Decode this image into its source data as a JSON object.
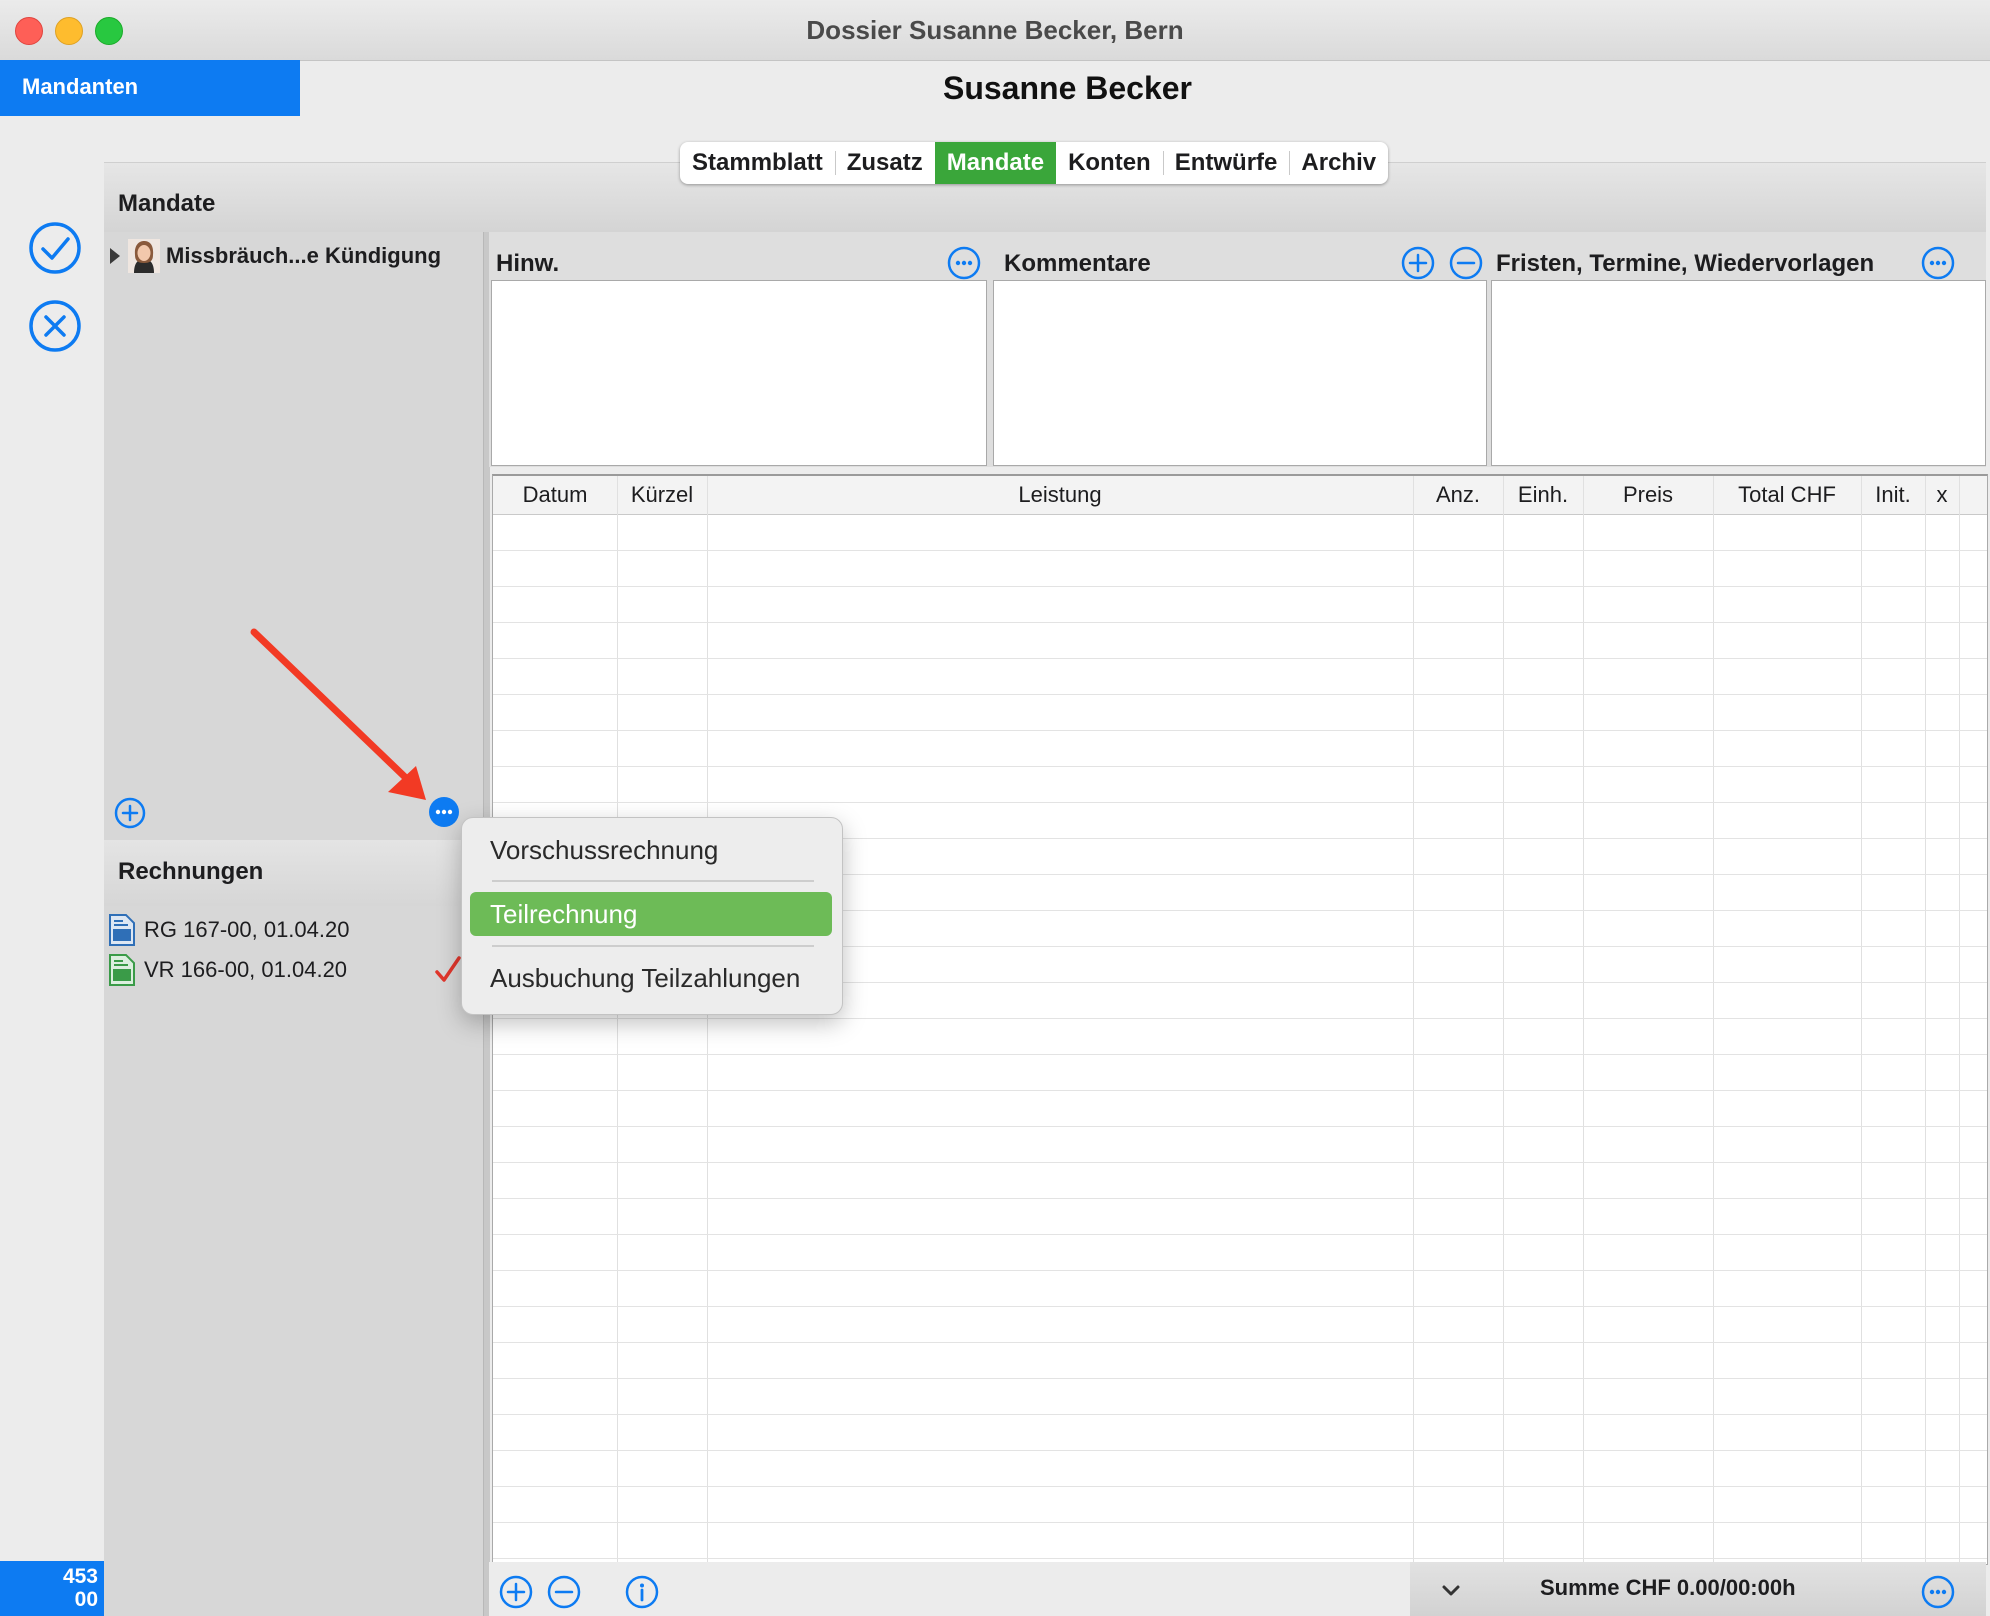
{
  "window": {
    "title": "Dossier Susanne Becker, Bern"
  },
  "nav": {
    "mandanten_label": "Mandanten"
  },
  "header": {
    "client_name": "Susanne Becker"
  },
  "tabs": [
    {
      "label": "Stammblatt",
      "active": false
    },
    {
      "label": "Zusatz",
      "active": false
    },
    {
      "label": "Mandate",
      "active": true
    },
    {
      "label": "Konten",
      "active": false
    },
    {
      "label": "Entwürfe",
      "active": false
    },
    {
      "label": "Archiv",
      "active": false
    }
  ],
  "sidebar": {
    "counter_top": "453",
    "counter_bottom": "00"
  },
  "mandate": {
    "section_title": "Mandate",
    "items": [
      {
        "label": "Missbräuch...e Kündigung"
      }
    ]
  },
  "invoices": {
    "section_title": "Rechnungen",
    "items": [
      {
        "label": "RG 167-00, 01.04.20",
        "icon": "invoice-doc-icon",
        "color": "#2f6fb7"
      },
      {
        "label": "VR 166-00, 01.04.20",
        "icon": "advance-invoice-doc-icon",
        "color": "#3a9b48"
      }
    ]
  },
  "panels": {
    "hinweise": "Hinw.",
    "kommentare": "Kommentare",
    "fristen": "Fristen, Termine, Wiedervorlagen"
  },
  "table": {
    "columns": [
      "Datum",
      "Kürzel",
      "Leistung",
      "Anz.",
      "Einh.",
      "Preis",
      "Total CHF",
      "Init.",
      "x"
    ],
    "rows": []
  },
  "footer": {
    "sum_label": "Summe CHF 0.00/00:00h"
  },
  "context_menu": {
    "items": [
      {
        "label": "Vorschussrechnung",
        "selected": false
      },
      {
        "label": "Teilrechnung",
        "selected": true
      },
      {
        "label": "Ausbuchung Teilzahlungen",
        "selected": false
      }
    ]
  },
  "colors": {
    "accent_blue": "#0d7bf2",
    "active_tab_green": "#3aa63a",
    "menu_highlight": "#6dbb57",
    "annotation_arrow": "#f23a24"
  }
}
